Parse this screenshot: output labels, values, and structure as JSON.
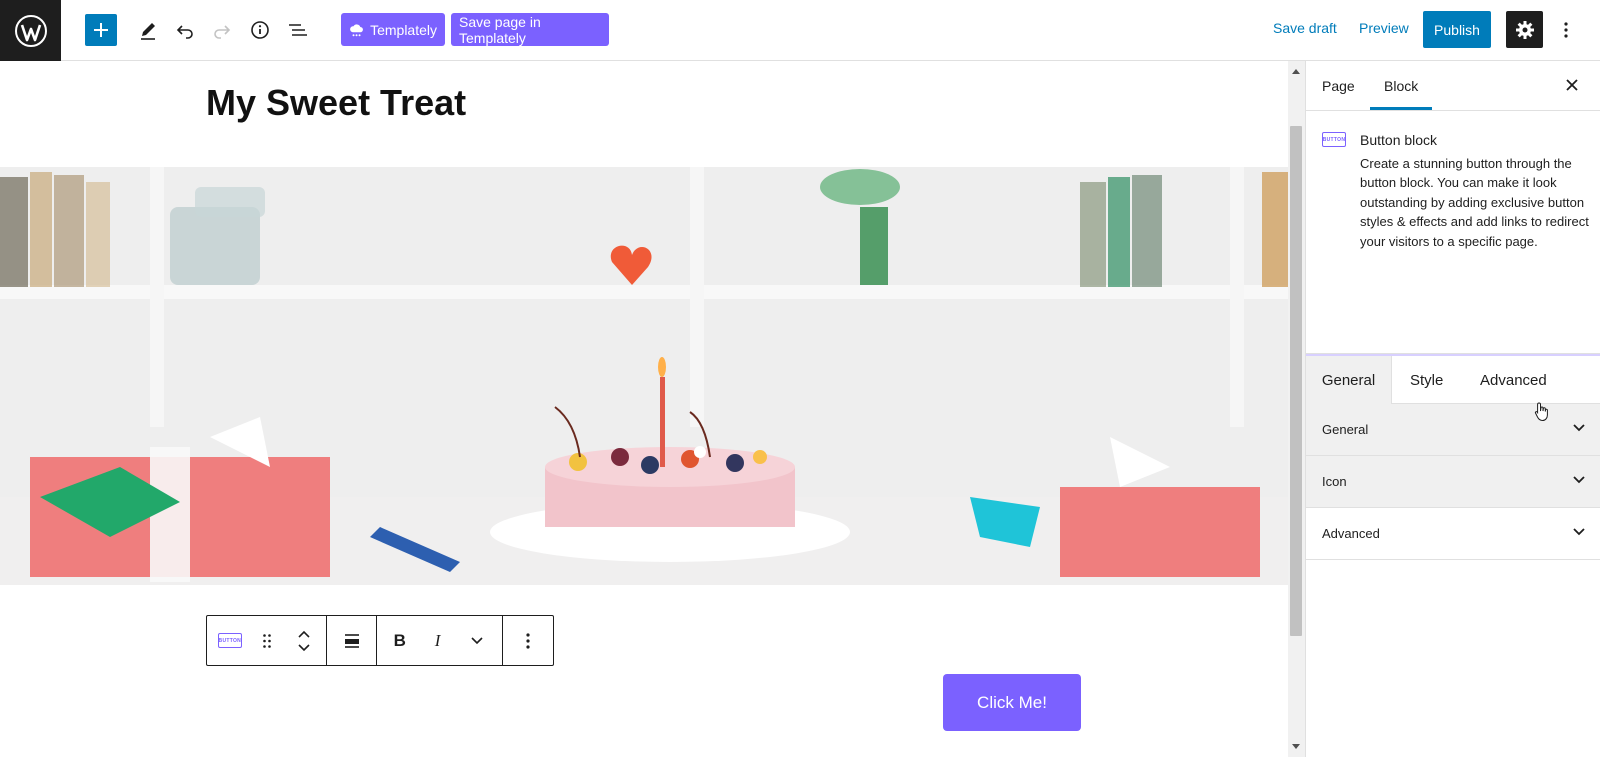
{
  "toolbar": {
    "templately_label": "Templately",
    "save_templately_label": "Save page in Templately",
    "save_draft_label": "Save draft",
    "preview_label": "Preview",
    "publish_label": "Publish"
  },
  "editor": {
    "page_title": "My Sweet Treat",
    "button_text": "Click Me!",
    "block_toolbar": {
      "bold_label": "B",
      "italic_label": "I",
      "badge_label": "BUTTON"
    }
  },
  "sidebar": {
    "tabs": [
      {
        "label": "Page"
      },
      {
        "label": "Block"
      }
    ],
    "block_card": {
      "title": "Button block",
      "description": "Create a stunning button through the button block. You can make it look outstanding by adding exclusive button styles & effects and add links to redirect your visitors to a specific page.",
      "badge_label": "BUTTON"
    },
    "sub_tabs": [
      {
        "label": "General"
      },
      {
        "label": "Style"
      },
      {
        "label": "Advanced"
      }
    ],
    "panels": [
      {
        "label": "General"
      },
      {
        "label": "Icon"
      },
      {
        "label": "Advanced"
      }
    ]
  },
  "colors": {
    "accent": "#007cba",
    "templately": "#7b61ff",
    "dark": "#1e1e1e"
  }
}
